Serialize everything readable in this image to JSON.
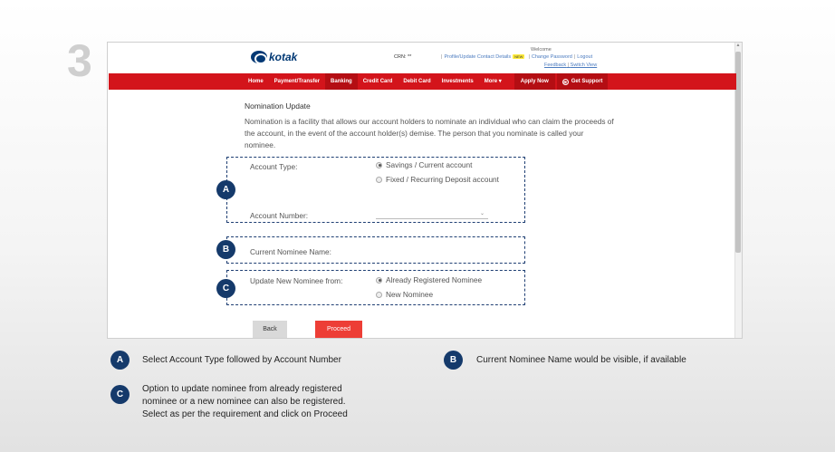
{
  "step": {
    "number": "3"
  },
  "header": {
    "logo_text": "kotak",
    "crn_label": "CRN: **",
    "links": [
      "Profile/Update Contact Details",
      "Change Password",
      "Logout"
    ],
    "new_badge": "NEW",
    "welcome": "Welcome",
    "feedback": "Feedback",
    "switch_view": "Switch View"
  },
  "nav": {
    "items": [
      "Home",
      "Payment/Transfer",
      "Banking",
      "Credit Card",
      "Debit Card",
      "Investments",
      "More"
    ],
    "more_caret": "▾",
    "active": "Banking",
    "apply_now": "Apply Now",
    "get_support": "Get Support"
  },
  "form": {
    "title": "Nomination Update",
    "description": "Nomination is a facility that allows our account holders to nominate an individual who can claim the proceeds of the account, in the event of the account holder(s) demise. The person that you nominate is called your nominee.",
    "account_type_label": "Account Type:",
    "account_type_options": [
      "Savings / Current account",
      "Fixed / Recurring Deposit account"
    ],
    "account_type_selected": "Savings / Current account",
    "account_number_label": "Account Number:",
    "current_nominee_label": "Current Nominee Name:",
    "update_from_label": "Update New Nominee from:",
    "nominee_options": [
      "Already Registered Nominee",
      "New Nominee"
    ],
    "nominee_selected": "Already Registered Nominee",
    "back_label": "Back",
    "proceed_label": "Proceed"
  },
  "badges": {
    "a": "A",
    "b": "B",
    "c": "C"
  },
  "legend": {
    "a_text": "Select Account Type followed by Account Number",
    "b_text": "Current Nominee Name would be visible, if available",
    "c_text": [
      "Option to update nominee from already registered",
      "nominee or a new nominee can also be registered.",
      "Select as per the requirement and click on Proceed"
    ]
  },
  "colors": {
    "brand_red": "#d3141b",
    "brand_navy": "#153a6b",
    "proceed_red": "#ed3e36"
  }
}
